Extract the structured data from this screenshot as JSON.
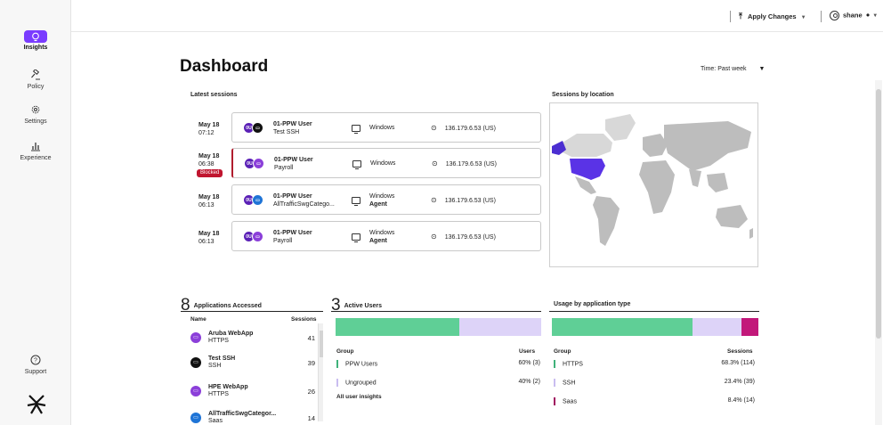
{
  "nav": {
    "items": [
      {
        "label": "Insights",
        "icon": "lightbulb-icon",
        "active": true
      },
      {
        "label": "Policy",
        "icon": "gavel-icon"
      },
      {
        "label": "Settings",
        "icon": "gear-icon"
      },
      {
        "label": "Experience",
        "icon": "bar-chart-icon"
      }
    ],
    "support": "Support"
  },
  "topbar": {
    "apply_label": "Apply Changes",
    "user_name": "shane"
  },
  "page": {
    "title": "Dashboard",
    "time_label": "Time:",
    "time_value": "Past week"
  },
  "latest_sessions": {
    "title": "Latest sessions",
    "rows": [
      {
        "date": "May 18",
        "time": "07:12",
        "blocked": "",
        "user": "01-PPW User",
        "app": "Test SSH",
        "os": "Windows",
        "agent": "",
        "ip": "136.179.6.53 (US)",
        "app_color": "dark"
      },
      {
        "date": "May 18",
        "time": "06:38",
        "blocked": "Blocked",
        "user": "01-PPW User",
        "app": "Payroll",
        "os": "Windows",
        "agent": "",
        "ip": "136.179.6.53 (US)",
        "app_color": "purple"
      },
      {
        "date": "May 18",
        "time": "06:13",
        "blocked": "",
        "user": "01-PPW User",
        "app": "AllTrafficSwgCatego...",
        "os": "Windows",
        "agent": "Agent",
        "ip": "136.179.6.53 (US)",
        "app_color": "blue"
      },
      {
        "date": "May 18",
        "time": "06:13",
        "blocked": "",
        "user": "01-PPW User",
        "app": "Payroll",
        "os": "Windows",
        "agent": "Agent",
        "ip": "136.179.6.53 (US)",
        "app_color": "purple"
      }
    ],
    "avatar_initials": "0U"
  },
  "sessions_by_location": {
    "title": "Sessions by location"
  },
  "applications": {
    "count": "8",
    "title": "Applications Accessed",
    "col_name": "Name",
    "col_sessions": "Sessions",
    "rows": [
      {
        "name": "Aruba WebApp",
        "proto": "HTTPS",
        "sessions": "41",
        "color": "#8b3fd9"
      },
      {
        "name": "Test SSH",
        "proto": "SSH",
        "sessions": "39",
        "color": "#111111"
      },
      {
        "name": "HPE WebApp",
        "proto": "HTTPS",
        "sessions": "26",
        "color": "#8b3fd9"
      },
      {
        "name": "AllTrafficSwgCategor...",
        "proto": "Saas",
        "sessions": "14",
        "color": "#1f74d6"
      }
    ]
  },
  "active_users": {
    "count": "3",
    "title": "Active Users",
    "col_group": "Group",
    "col_users": "Users",
    "bar": [
      {
        "share": 60,
        "color": "#5fcf96"
      },
      {
        "share": 40,
        "color": "#ddd3f8"
      }
    ],
    "rows": [
      {
        "group": "PPW Users",
        "value": "60% (3)",
        "color": "#3fb27a"
      },
      {
        "group": "Ungrouped",
        "value": "40% (2)",
        "color": "#c9bdf0"
      }
    ],
    "footer": "All user insights"
  },
  "usage": {
    "title": "Usage by application type",
    "col_group": "Group",
    "col_sessions": "Sessions",
    "bar": [
      {
        "share": 68.3,
        "color": "#5fcf96"
      },
      {
        "share": 23.4,
        "color": "#ddd3f8"
      },
      {
        "share": 8.4,
        "color": "#c2187a"
      }
    ],
    "rows": [
      {
        "group": "HTTPS",
        "value": "68.3% (114)",
        "color": "#3fb27a"
      },
      {
        "group": "SSH",
        "value": "23.4% (39)",
        "color": "#c9bdf0"
      },
      {
        "group": "Saas",
        "value": "8.4% (14)",
        "color": "#a0105f"
      }
    ]
  }
}
